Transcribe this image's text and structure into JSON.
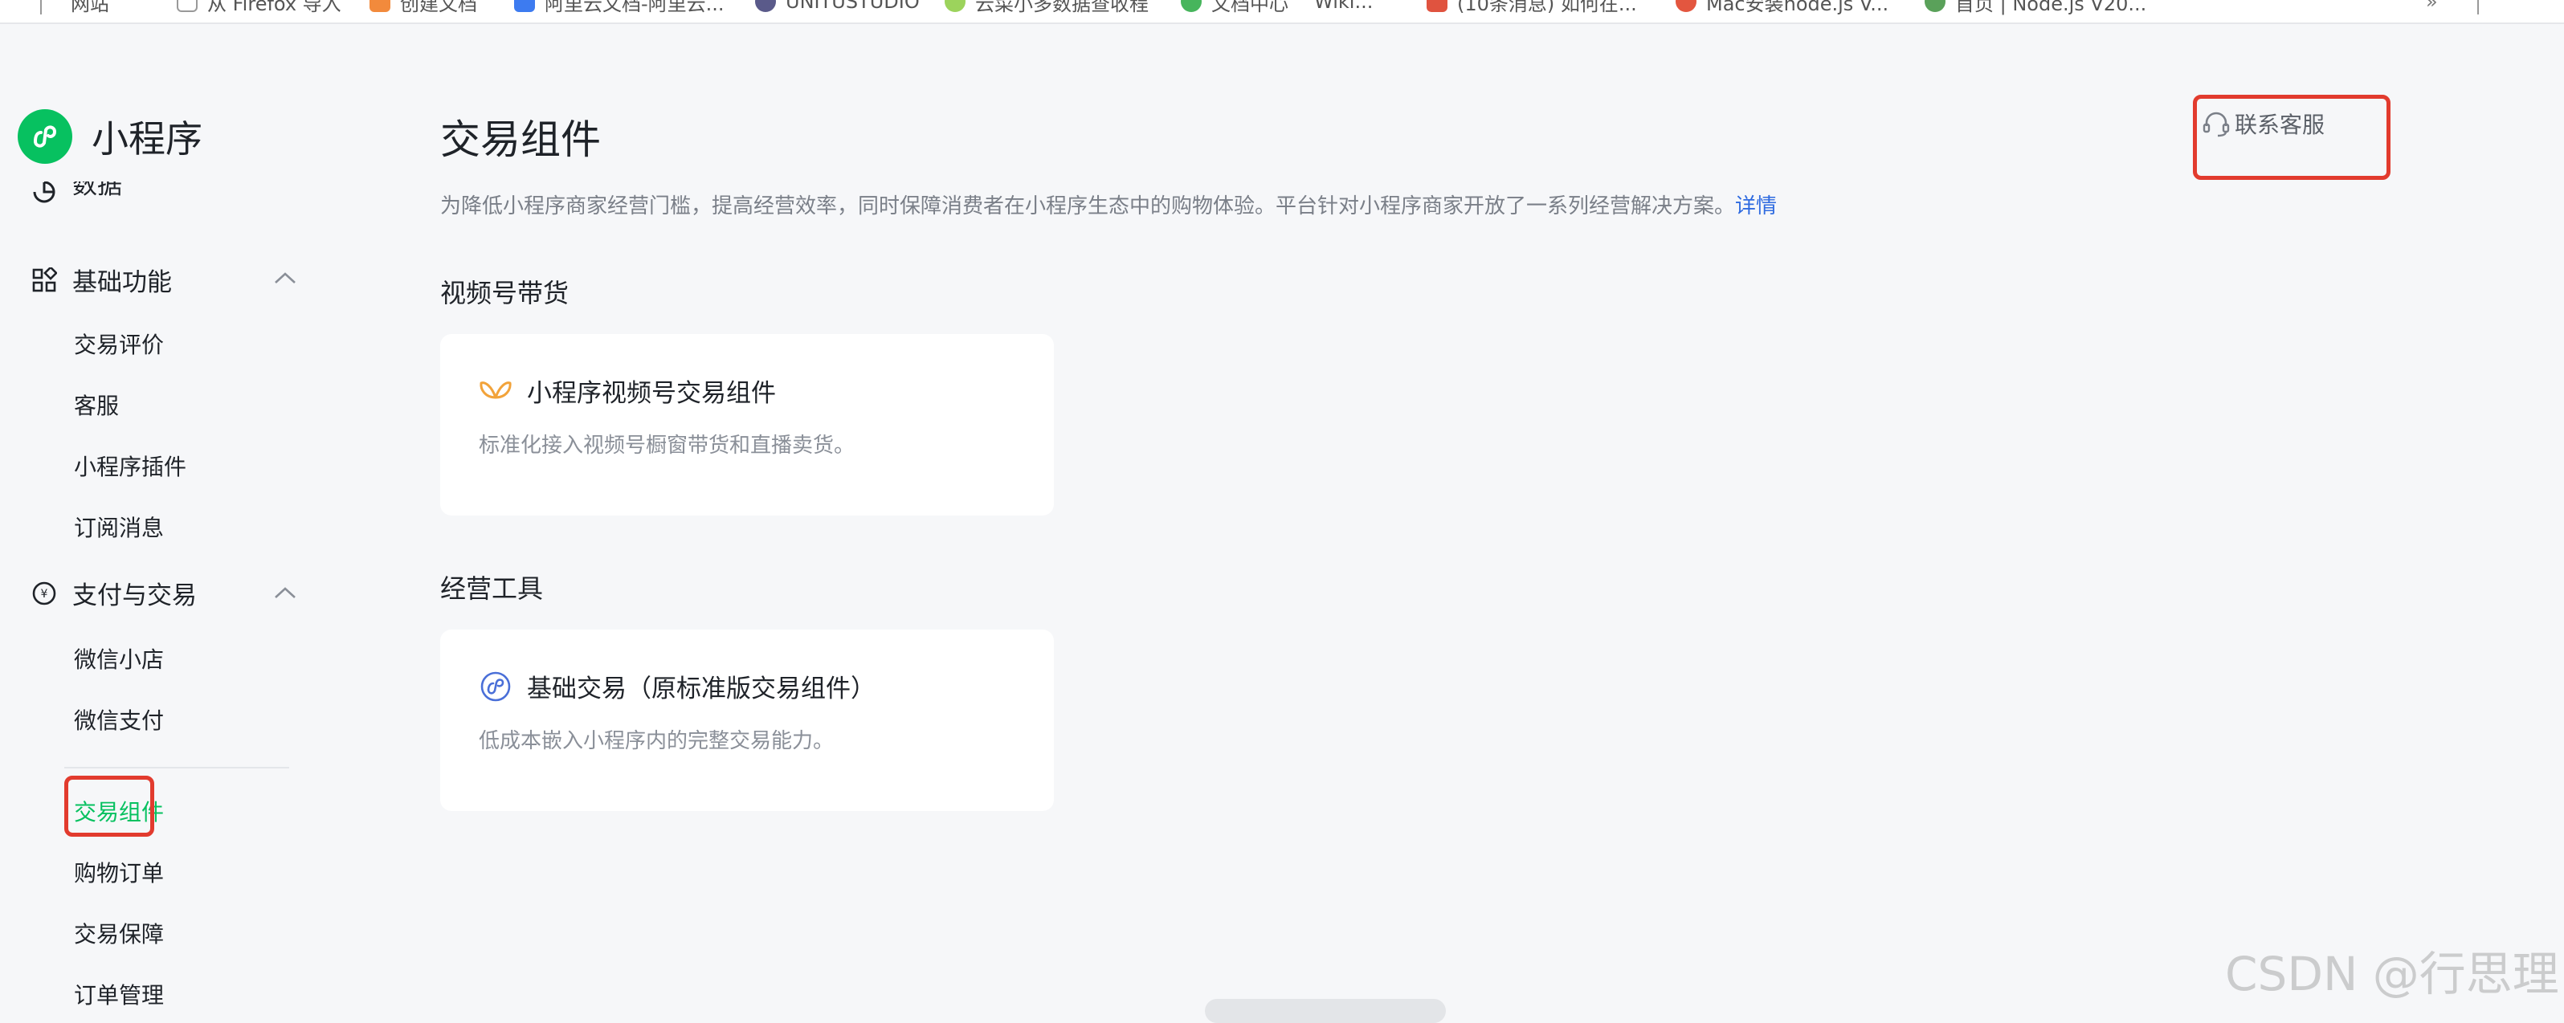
{
  "bookmarks": [
    {
      "label": "网站",
      "color": "#888888"
    },
    {
      "label": "从 Firefox 导入",
      "color": "#999999"
    },
    {
      "label": "创建文档",
      "color": "#f28a3c"
    },
    {
      "label": "阿里云文档-阿里云...",
      "color": "#3d7bf0"
    },
    {
      "label": "UNITUSTUDIO",
      "color": "#5a5a8a"
    },
    {
      "label": "云菜小多数据查收程",
      "color": "#9cd35c"
    },
    {
      "label": "文档中心",
      "color": "#47b55c"
    },
    {
      "label": "Wiki...",
      "color": "#888888"
    },
    {
      "label": "(10条消息) 如何在...",
      "color": "#e0533f"
    },
    {
      "label": "Mac安装node.js V...",
      "color": "#e3563f"
    },
    {
      "label": "首页 | Node.js V20...",
      "color": "#5aa15a"
    }
  ],
  "brand": {
    "name": "小程序",
    "accent": "#07c160"
  },
  "sidebar": {
    "partial_item": "数据",
    "groups": [
      {
        "label": "基础功能",
        "icon": "grid-icon",
        "items": [
          "交易评价",
          "客服",
          "小程序插件",
          "订阅消息"
        ]
      },
      {
        "label": "支付与交易",
        "icon": "yen-circle-icon",
        "items": [
          "微信小店",
          "微信支付",
          "交易组件",
          "购物订单",
          "交易保障",
          "订单管理"
        ]
      }
    ],
    "active_item": "交易组件"
  },
  "main": {
    "title": "交易组件",
    "description": "为降低小程序商家经营门槛，提高经营效率，同时保障消费者在小程序生态中的购物体验。平台针对小程序商家开放了一系列经营解决方案。",
    "details_link": "详情",
    "contact_button": "联系客服",
    "sections": [
      {
        "title": "视频号带货",
        "cards": [
          {
            "icon": "channels-butterfly-icon",
            "title": "小程序视频号交易组件",
            "desc": "标准化接入视频号橱窗带货和直播卖货。"
          }
        ]
      },
      {
        "title": "经营工具",
        "cards": [
          {
            "icon": "miniprogram-icon",
            "title": "基础交易（原标准版交易组件）",
            "desc": "低成本嵌入小程序内的完整交易能力。"
          }
        ]
      }
    ]
  },
  "watermark": "CSDN @行思理"
}
